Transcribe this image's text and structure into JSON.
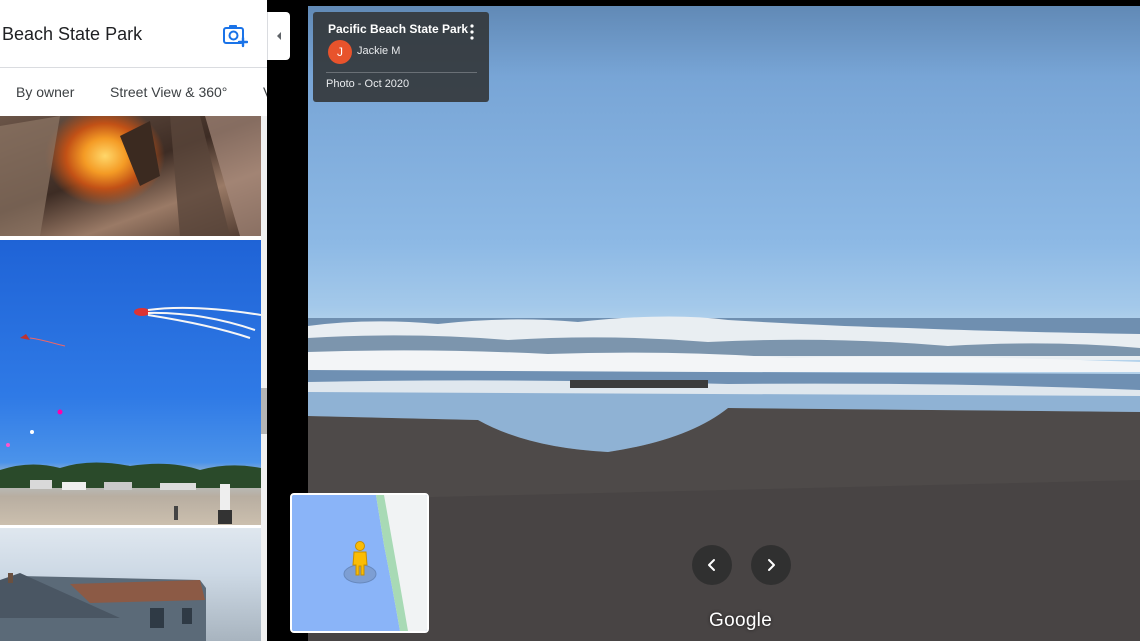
{
  "place_panel": {
    "title": "ific Beach State Park",
    "tabs": [
      "By owner",
      "Street View & 360°",
      "V"
    ],
    "photo_thumbnails": [
      "campfire-photo",
      "kites-on-beach-photo",
      "beach-house-photo"
    ]
  },
  "photo_info": {
    "place_name": "Pacific Beach State Park",
    "author_initial": "J",
    "author_name": "Jackie M",
    "date_label": "Photo - Oct 2020"
  },
  "branding": {
    "logo_text": "Google"
  },
  "icons": {
    "add_photo": "camera-plus-icon",
    "collapse": "caret-left-icon",
    "more": "more-vert-icon",
    "previous": "chevron-left-icon",
    "next": "chevron-right-icon",
    "pegman": "pegman-icon"
  },
  "colors": {
    "accent_blue": "#1a73e8",
    "avatar": "#e8532c",
    "card_background": "#34383c",
    "map_water": "#8ab4f8",
    "map_land": "#f1f3f4",
    "map_shore": "#a8dab5",
    "pegman": "#fbbc04"
  }
}
